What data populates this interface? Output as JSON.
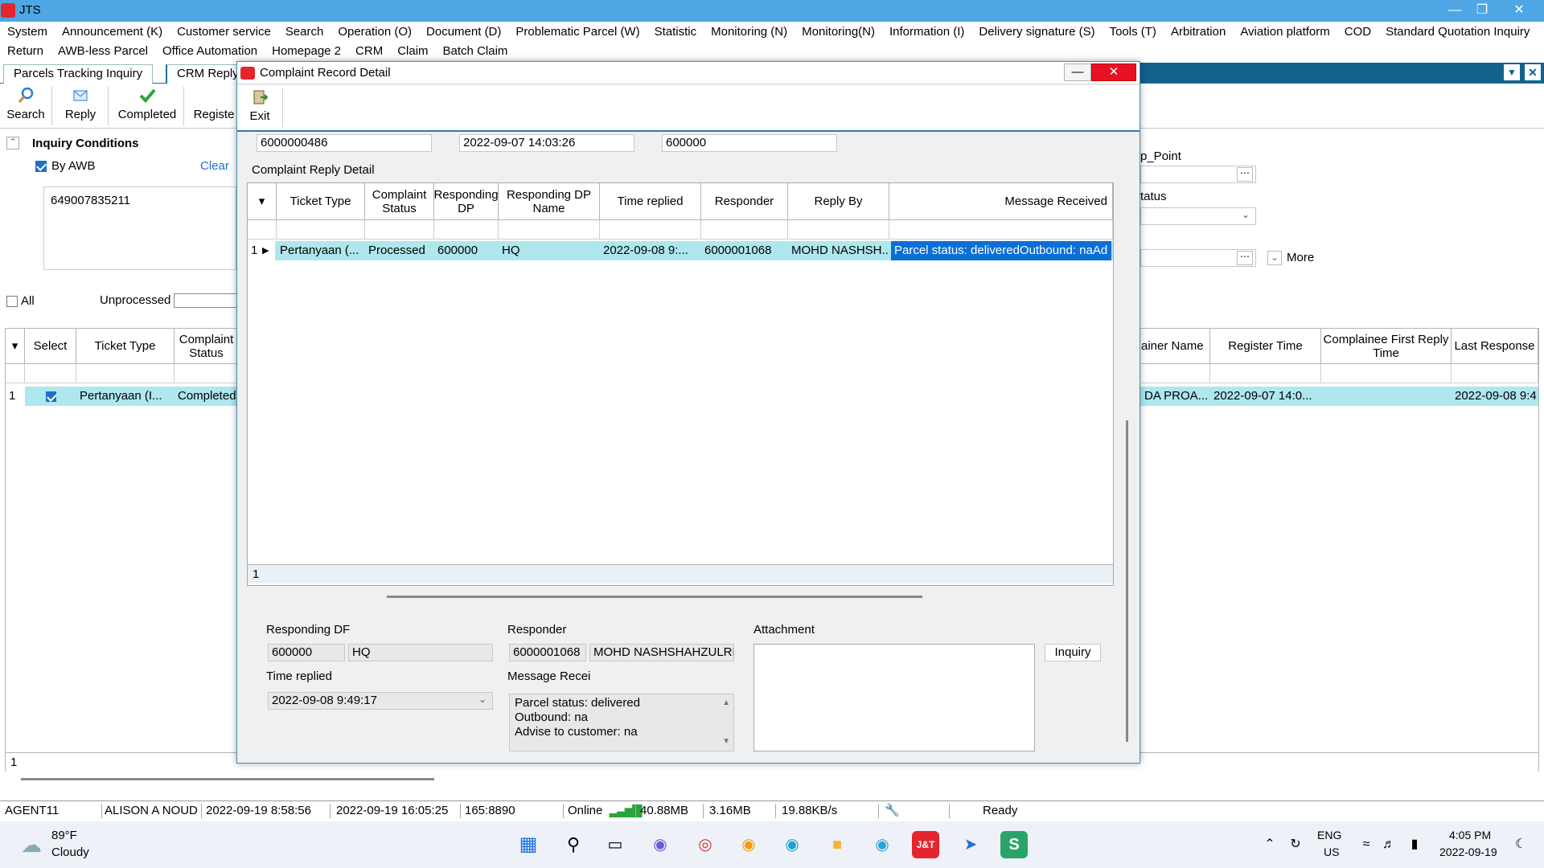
{
  "app": {
    "title": "JTS"
  },
  "menu1": [
    "System",
    "Announcement (K)",
    "Customer service",
    "Search",
    "Operation (O)",
    "Document (D)",
    "Problematic Parcel (W)",
    "Statistic",
    "Monitoring (N)",
    "Monitoring(N)",
    "Information (I)",
    "Delivery signature (S)",
    "Tools (T)",
    "Arbitration",
    "Aviation platform",
    "COD",
    "Standard Quotation Inquiry"
  ],
  "menu2": [
    "Return",
    "AWB-less Parcel",
    "Office Automation",
    "Homepage 2",
    "CRM",
    "Claim",
    "Batch Claim"
  ],
  "tabs": [
    "Parcels Tracking Inquiry",
    "CRM Reply"
  ],
  "toolbar": {
    "search": "Search",
    "reply": "Reply",
    "completed": "Completed",
    "register": "Registe"
  },
  "inquiry": {
    "title": "Inquiry Conditions",
    "by_awb": "By AWB",
    "clear": "Clear",
    "awb_value": "649007835211",
    "all": "All",
    "unprocessed": "Unprocessed",
    "right_label1": "p_Point",
    "right_label2": "tatus",
    "more": "More"
  },
  "grid": {
    "headers": {
      "select": "Select",
      "ticket_type": "Ticket Type",
      "complaint_status": "Complaint Status",
      "ainer_name": "ainer Name",
      "register_time": "Register Time",
      "first_reply": "Complainee First Reply Time",
      "last_response": "Last Response"
    },
    "row": {
      "num": "1",
      "ticket_type": "Pertanyaan (I...",
      "status": "Completed",
      "ainer": "DA PROA...",
      "register": "2022-09-07 14:0...",
      "first_reply": "",
      "last": "2022-09-08 9:4"
    },
    "footer_count": "1"
  },
  "dialog": {
    "title": "Complaint Record Detail",
    "exit": "Exit",
    "field1": "6000000486",
    "field2": "2022-09-07 14:03:26",
    "field3": "600000",
    "section": "Complaint Reply Detail",
    "headers": {
      "ticket_type": "Ticket Type",
      "complaint_status": "Complaint Status",
      "responding_dp": "Responding DP",
      "responding_dp_name": "Responding DP Name",
      "time_replied": "Time replied",
      "responder": "Responder",
      "reply_by": "Reply By",
      "message": "Message Received"
    },
    "row": {
      "num": "1",
      "ticket_type": "Pertanyaan (...",
      "status": "Processed",
      "dp": "600000",
      "dp_name": "HQ",
      "time": "2022-09-08 9:...",
      "responder": "6000001068",
      "reply_by": "MOHD NASHSH...",
      "message": "Parcel status: deliveredOutbound: naAd"
    },
    "footer_count": "1",
    "detail": {
      "responding_dp_label": "Responding DF",
      "dp_code": "600000",
      "dp_name": "HQ",
      "responder_label": "Responder",
      "responder_id": "6000001068",
      "responder_name": "MOHD NASHSHAHZULREZ",
      "attachment_label": "Attachment",
      "inquiry_btn": "Inquiry",
      "time_replied_label": "Time replied",
      "time_replied": "2022-09-08 9:49:17",
      "message_label": "Message Recei",
      "message_line1": "Parcel status: delivered",
      "message_line2": "Outbound: na",
      "message_line3": "Advise to customer: na"
    }
  },
  "status": {
    "agent": "AGENT11",
    "user": "ALISON A NOUD",
    "login": "2022-09-19 8:58:56",
    "now": "2022-09-19 16:05:25",
    "server": "165:8890",
    "online": "Online",
    "mem1": "40.88MB",
    "mem2": "3.16MB",
    "speed": "19.88KB/s",
    "ready": "Ready"
  },
  "taskbar": {
    "temp": "89°F",
    "weather": "Cloudy",
    "lang1": "ENG",
    "lang2": "US",
    "time": "4:05 PM",
    "date": "2022-09-19"
  },
  "colors": {
    "accent": "#4ea7e4",
    "selected_row": "#aee7ee",
    "dark_tab": "#13628c",
    "highlight": "#0b6fd7"
  }
}
